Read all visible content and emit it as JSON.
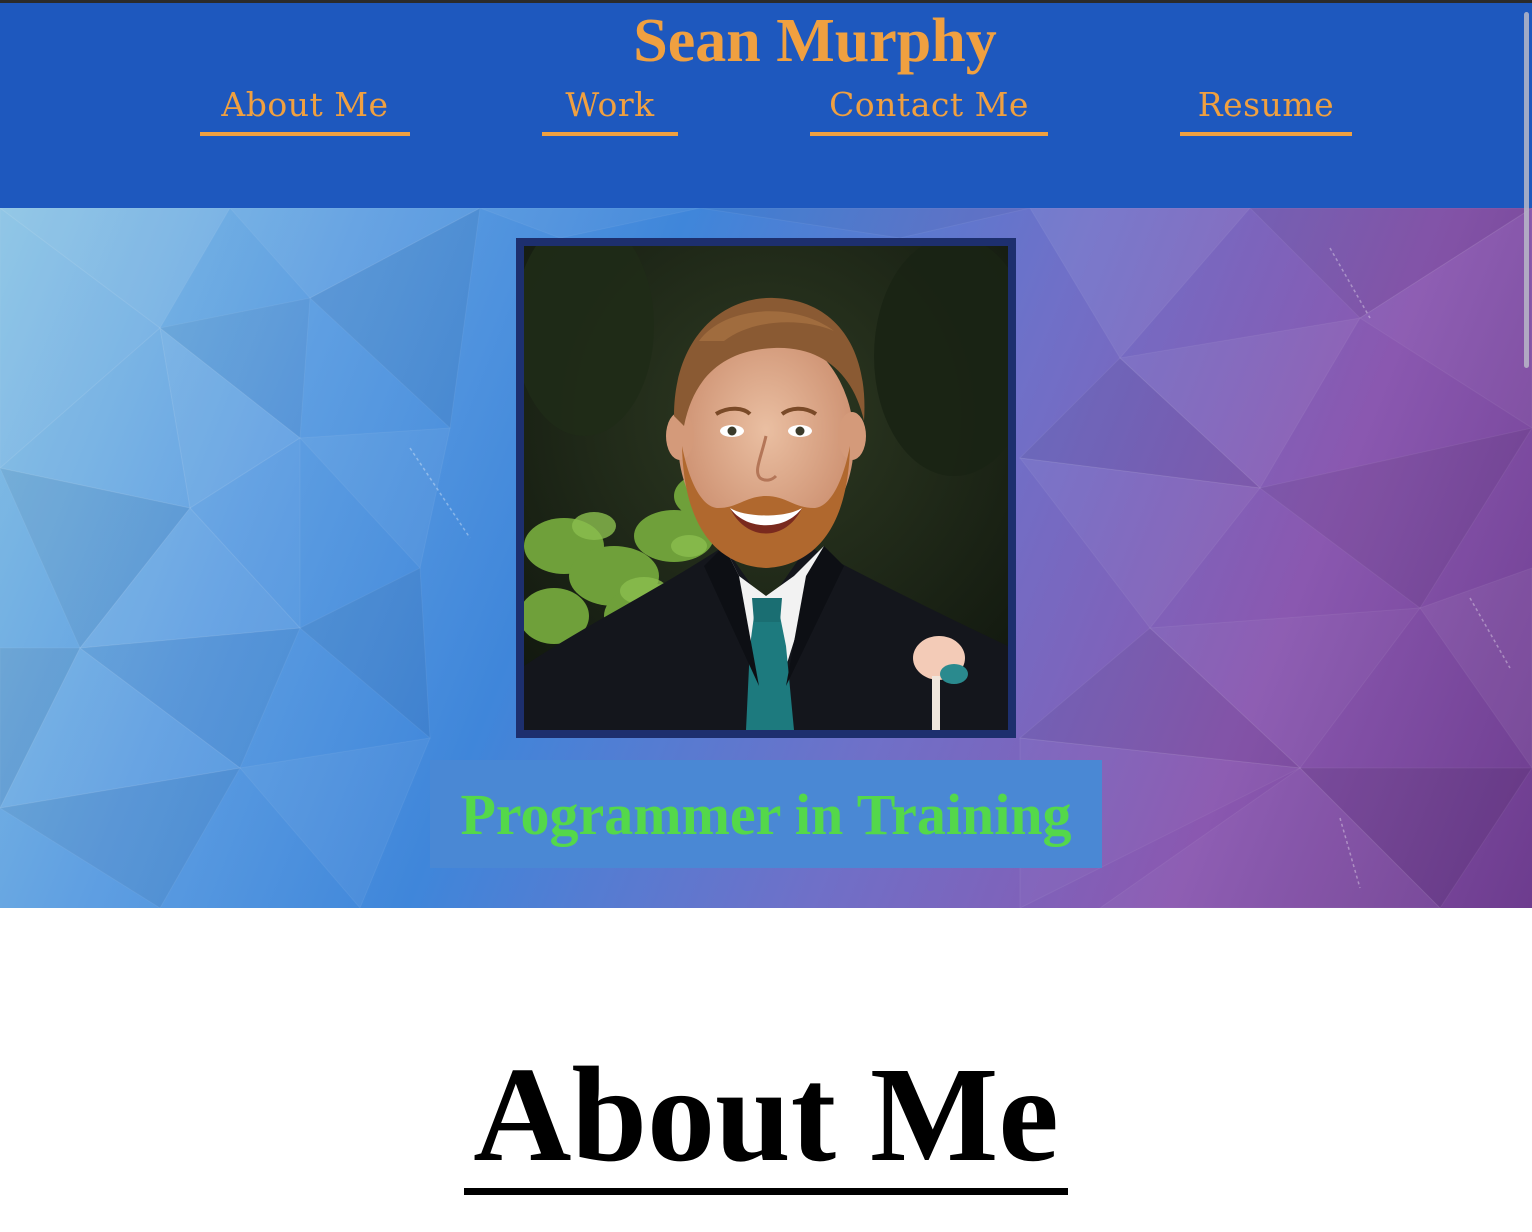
{
  "header": {
    "site_title": "Sean Murphy",
    "nav": [
      {
        "label": "About Me"
      },
      {
        "label": "Work"
      },
      {
        "label": "Contact Me"
      },
      {
        "label": "Resume"
      }
    ]
  },
  "hero": {
    "profile_photo": "profile-photo",
    "tagline": "Programmer in Training"
  },
  "about": {
    "heading": "About Me"
  },
  "colors": {
    "header_bg": "#1e58be",
    "accent": "#f0a040",
    "tagline_text": "#54d84a",
    "tagline_bg": "#4a88d4"
  }
}
